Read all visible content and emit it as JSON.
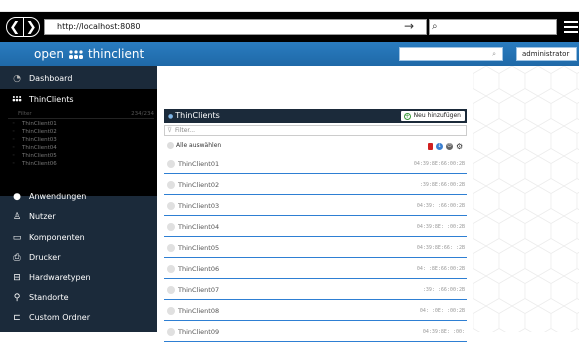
{
  "browser": {
    "url": "http://localhost:8080",
    "back_glyph": "❮",
    "forward_glyph": "❯",
    "go_glyph": "→",
    "search_glyph": "⌕"
  },
  "header": {
    "logo_open": "open",
    "logo_thin": "thinclient",
    "user": "administrator ⌄",
    "search_glyph": "⌕"
  },
  "sidebar": {
    "dashboard": "Dashboard",
    "active": "ThinClients",
    "filter_label": "Filter",
    "filter_count": "234/234",
    "subitems": [
      "ThinClient01",
      "ThinClient02",
      "ThinClient03",
      "ThinClient04",
      "ThinClient05",
      "ThinClient06"
    ],
    "items": [
      {
        "label": "Anwendungen",
        "icon": "●"
      },
      {
        "label": "Nutzer",
        "icon": "♙"
      },
      {
        "label": "Komponenten",
        "icon": "▭"
      },
      {
        "label": "Drucker",
        "icon": "⎙"
      },
      {
        "label": "Hardwaretypen",
        "icon": "⊟"
      },
      {
        "label": "Standorte",
        "icon": "⚲"
      },
      {
        "label": "Custom Ordner",
        "icon": "⊏"
      }
    ]
  },
  "panel": {
    "title": "ThinClients",
    "add_label": "Neu hinzufügen",
    "filter_placeholder": "Filter...",
    "select_all": "Alle auswählen",
    "rows": [
      {
        "name": "ThinClient01",
        "mac": "04:39:8E:66:00:2B"
      },
      {
        "name": "ThinClient02",
        "mac": ":39:8E:66:00:2B"
      },
      {
        "name": "ThinClient03",
        "mac": "04:39:  :66:00:2B"
      },
      {
        "name": "ThinClient04",
        "mac": "04:39:8E:  :00:2B"
      },
      {
        "name": "ThinClient05",
        "mac": "04:39:8E:66:  :2B"
      },
      {
        "name": "ThinClient06",
        "mac": "04:  :8E:66:00:2B"
      },
      {
        "name": "ThinClient07",
        "mac": ":39:  :66:00:2B"
      },
      {
        "name": "ThinClient08",
        "mac": "04:  :0E:  :00:2B"
      },
      {
        "name": "ThinClient09",
        "mac": "04:39:8E:  :00:"
      }
    ]
  }
}
